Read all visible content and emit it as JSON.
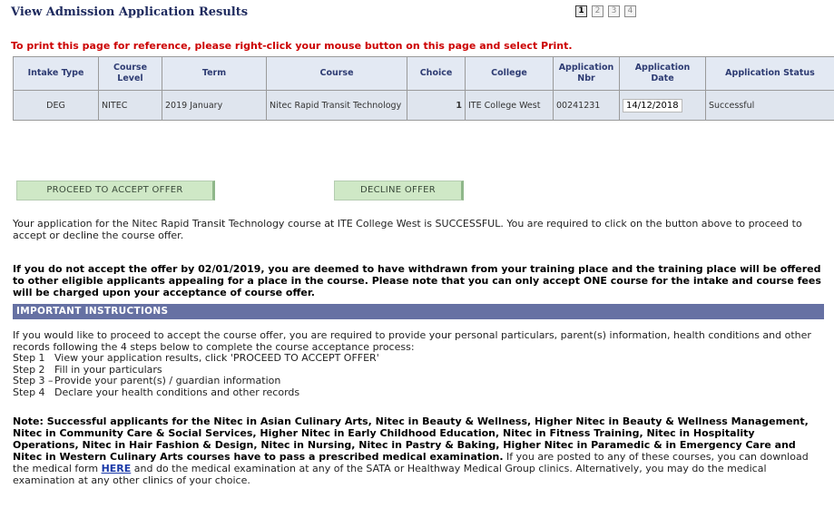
{
  "header": {
    "title": "View Admission Application Results",
    "pager": [
      "1",
      "2",
      "3",
      "4"
    ]
  },
  "print_note": "To print this page for reference, please right-click your mouse button on this page and select Print.",
  "table": {
    "columns": [
      "Intake Type",
      "Course Level",
      "Term",
      "Course",
      "Choice",
      "College",
      "Application Nbr",
      "Application Date",
      "Application Status"
    ],
    "rows": [
      {
        "intake_type": "DEG",
        "course_level": "NITEC",
        "term": "2019 January",
        "course": "Nitec Rapid Transit Technology",
        "choice": "1",
        "college": "ITE College West",
        "application_nbr": "00241231",
        "application_date": "14/12/2018",
        "application_status": "Successful"
      }
    ]
  },
  "buttons": {
    "proceed": "PROCEED TO ACCEPT OFFER",
    "decline": "DECLINE OFFER"
  },
  "result_text": "Your application for the Nitec Rapid Transit Technology course at ITE College West is SUCCESSFUL. You are required to click on the button above to proceed to accept or decline the course offer.",
  "warning_text": "If you do not accept the offer by 02/01/2019, you are deemed to have withdrawn from your training place and the training place will be offered to other eligible applicants appealing for a place in the course. Please note that you can only accept ONE course for the intake and course fees will be charged upon your acceptance of course offer.",
  "instructions": {
    "header": "IMPORTANT INSTRUCTIONS",
    "intro": "If you would like to proceed to accept the course offer, you are required to provide your personal particulars, parent(s) information, health conditions and other records following the 4 steps below to complete the course acceptance process:",
    "steps": [
      {
        "num": "Step 1",
        "text": "View your application results, click 'PROCEED TO ACCEPT OFFER'"
      },
      {
        "num": "Step 2",
        "text": "Fill in your particulars"
      },
      {
        "num": "Step 3 –",
        "text": "Provide your parent(s) / guardian information"
      },
      {
        "num": "Step 4",
        "text": "Declare your health conditions and other records"
      }
    ]
  },
  "note": {
    "bold_part": "Note: Successful applicants for the Nitec in Asian Culinary Arts, Nitec in Beauty & Wellness, Higher Nitec in Beauty & Wellness Management, Nitec in Community Care & Social Services, Higher Nitec in Early Childhood Education, Nitec in Fitness Training, Nitec in Hospitality Operations, Nitec in Hair Fashion & Design, Nitec in Nursing, Nitec in Pastry & Baking, Higher Nitec in Paramedic & in Emergency Care and Nitec in Western Culinary Arts courses have to pass a prescribed medical examination.",
    "reg_part_1": " If you are posted to any of these courses, you can download the medical form ",
    "link": "HERE",
    "reg_part_2": " and do the medical examination at any of the SATA or Healthway Medical Group clinics. Alternatively, you may do the medical examination at any other clinics of your choice."
  }
}
